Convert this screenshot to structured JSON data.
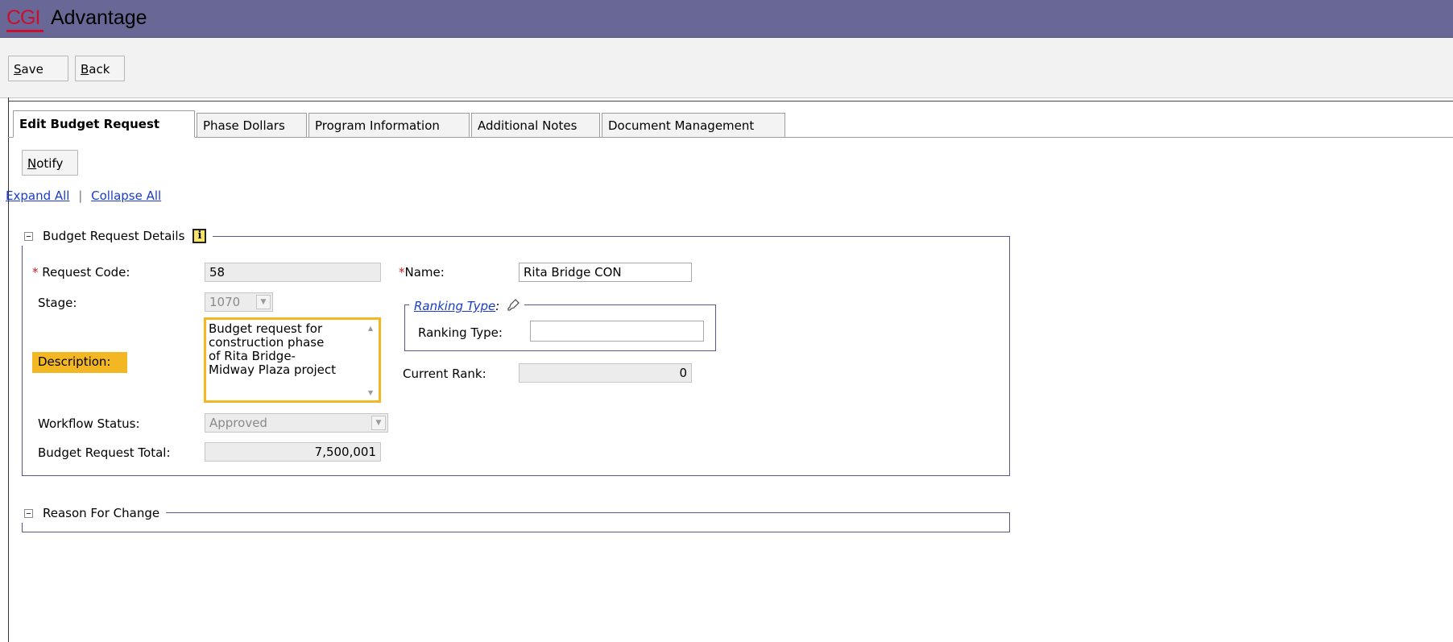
{
  "app": {
    "logo": "CGI",
    "name": "Advantage"
  },
  "toolbar": {
    "save": {
      "access_key": "S",
      "rest": "ave"
    },
    "back": {
      "access_key": "B",
      "rest": "ack"
    }
  },
  "tabs": [
    {
      "label": "Edit Budget Request",
      "active": true
    },
    {
      "label": "Phase Dollars",
      "active": false
    },
    {
      "label": "Program Information",
      "active": false
    },
    {
      "label": "Additional Notes",
      "active": false
    },
    {
      "label": "Document Management",
      "active": false
    }
  ],
  "actions": {
    "notify": {
      "access_key": "N",
      "rest": "otify"
    }
  },
  "links": {
    "expand_all": "Expand All",
    "separator": "|",
    "collapse_all": "Collapse All"
  },
  "budget_request_details": {
    "title": "Budget Request Details",
    "required_marker": "*",
    "request_code": {
      "label": "Request Code:",
      "value": "58"
    },
    "name": {
      "label": "Name:",
      "value": "Rita Bridge CON"
    },
    "stage": {
      "label": "Stage:",
      "value": "1070"
    },
    "ranking_type_group": {
      "legend": "Ranking Type",
      "legend_suffix": ":",
      "field_label": "Ranking Type:",
      "value": ""
    },
    "description": {
      "label": "Description:",
      "value": "Budget request for\nconstruction phase\nof Rita Bridge-\nMidway Plaza project"
    },
    "current_rank": {
      "label": "Current Rank:",
      "value": "0"
    },
    "workflow_status": {
      "label": "Workflow Status:",
      "value": "Approved"
    },
    "budget_request_total": {
      "label": "Budget Request Total:",
      "value": "7,500,001"
    }
  },
  "reason_for_change": {
    "title": "Reason For Change"
  },
  "colors": {
    "header": "#686796",
    "accent_red": "#c8102e",
    "highlight": "#f3b724",
    "link": "#1a3cc8",
    "section_border": "#57578d"
  },
  "icons": [
    "info-icon",
    "pin-icon",
    "collapse-icon",
    "chevron-down-icon"
  ]
}
